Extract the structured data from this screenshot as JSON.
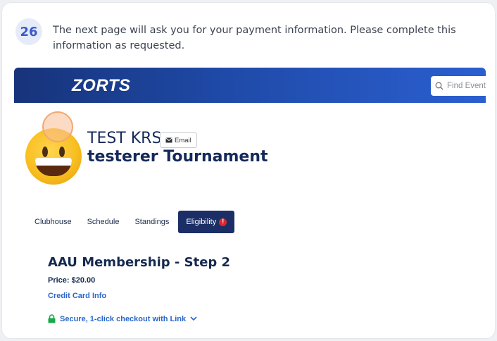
{
  "step": {
    "number": "26",
    "instruction": "The next page will ask you for your payment information. Please complete this information as requested."
  },
  "header": {
    "logo_text": "ZORTS",
    "search_placeholder": "Find Event"
  },
  "team": {
    "name": "TEST KRS",
    "email_label": "Email",
    "event": "testerer Tournament"
  },
  "tabs": [
    {
      "label": "Clubhouse"
    },
    {
      "label": "Schedule"
    },
    {
      "label": "Standings"
    },
    {
      "label": "Eligibility",
      "active": true
    }
  ],
  "membership": {
    "heading": "AAU Membership - Step 2",
    "price": "Price: $20.00",
    "credit_card_label": "Credit Card Info",
    "secure_checkout": "Secure, 1-click checkout with Link"
  },
  "colors": {
    "topbar": "#1f4aa8",
    "active_tab": "#1b2f66",
    "link": "#2b66c9",
    "secure_icon": "#1ba84a",
    "alert": "#e0262b"
  },
  "icons": [
    "search-icon",
    "envelope-icon",
    "alert-icon",
    "lock-icon",
    "chevron-down-icon"
  ]
}
